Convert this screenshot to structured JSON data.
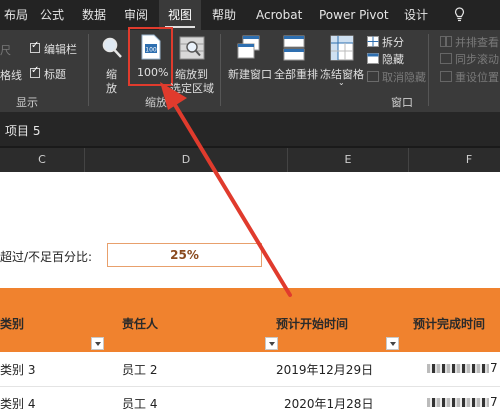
{
  "tabs": [
    {
      "label": "布局",
      "active": false
    },
    {
      "label": "公式",
      "active": false
    },
    {
      "label": "数据",
      "active": false
    },
    {
      "label": "审阅",
      "active": false
    },
    {
      "label": "视图",
      "active": true
    },
    {
      "label": "帮助",
      "active": false
    },
    {
      "label": "Acrobat",
      "active": false
    },
    {
      "label": "Power Pivot",
      "active": false
    },
    {
      "label": "设计",
      "active": false
    }
  ],
  "ribbon": {
    "show_group": {
      "ruler_partial": "尺",
      "gridlines_partial": "格线",
      "formula_bar": "编辑栏",
      "headings": "标题",
      "group_label": "显示"
    },
    "zoom_group": {
      "zoom_label_line1": "缩",
      "zoom_label_line2": "放",
      "zoom100_label": "100%",
      "zoom_selection_line1": "缩放到",
      "zoom_selection_line2": "选定区域",
      "group_label": "缩放"
    },
    "window_group": {
      "new_window": "新建窗口",
      "arrange_all": "全部重排",
      "freeze_panes": "冻结窗格",
      "split": "拆分",
      "hide": "隐藏",
      "unhide": "取消隐藏",
      "view_side_by_side": "并排查看",
      "sync_scroll": "同步滚动",
      "reset_position": "重设位置",
      "group_label": "窗口"
    }
  },
  "formula_bar": {
    "name_box": "项目 5"
  },
  "columns": [
    "C",
    "D",
    "E",
    "F"
  ],
  "sheet": {
    "threshold_label": "超过/不足百分比:",
    "threshold_value": "25%",
    "headers": [
      "类别",
      "责任人",
      "预计开始时间",
      "预计完成时间"
    ],
    "rows": [
      {
        "category": "类别 3",
        "owner": "员工 2",
        "start": "2019年12月29日",
        "end_suffix": "7"
      },
      {
        "category": "类别 4",
        "owner": "员工 4",
        "start": "2020年1月28日",
        "end_suffix": "7"
      }
    ]
  },
  "colors": {
    "accent_orange": "#f0822e",
    "annotation_red": "#e03b2d",
    "ribbon_bg": "#3a3a3a"
  }
}
